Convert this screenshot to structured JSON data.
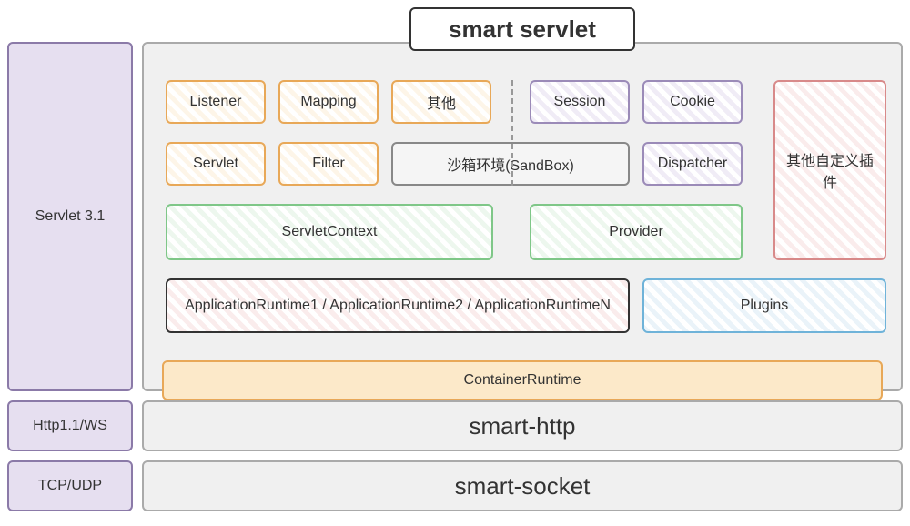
{
  "title": "smart servlet",
  "sidebar": {
    "servlet_spec": "Servlet 3.1",
    "http_protocol": "Http1.1/WS",
    "transport": "TCP/UDP"
  },
  "components": {
    "listener": "Listener",
    "mapping": "Mapping",
    "other": "其他",
    "servlet": "Servlet",
    "filter": "Filter",
    "sandbox": "沙箱环境(SandBox)",
    "session": "Session",
    "cookie": "Cookie",
    "dispatcher": "Dispatcher",
    "custom_plugins": "其他自定义插件",
    "servlet_context": "ServletContext",
    "provider": "Provider",
    "app_runtime": "ApplicationRuntime1 / ApplicationRuntime2 / ApplicationRuntimeN",
    "plugins": "Plugins",
    "container_runtime": "ContainerRuntime"
  },
  "layers": {
    "smart_http": "smart-http",
    "smart_socket": "smart-socket"
  }
}
